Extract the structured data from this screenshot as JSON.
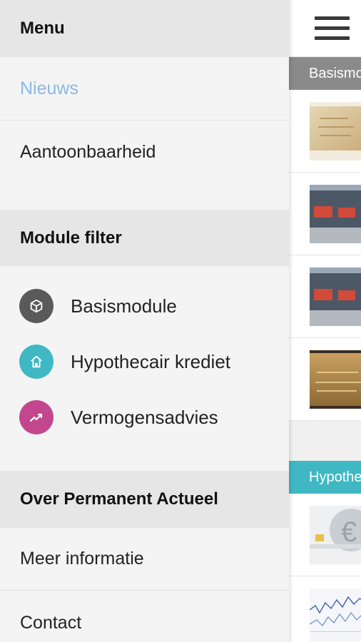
{
  "menu": {
    "title": "Menu",
    "items": [
      {
        "label": "Nieuws",
        "active": true
      },
      {
        "label": "Aantoonbaarheid",
        "active": false
      }
    ]
  },
  "module_filter": {
    "title": "Module filter",
    "items": [
      {
        "label": "Basismodule",
        "icon": "cube-icon",
        "color": "#5a5a5a"
      },
      {
        "label": "Hypothecair krediet",
        "icon": "house-icon",
        "color": "#3fb8c4"
      },
      {
        "label": "Vermogensadvies",
        "icon": "trend-line-icon",
        "color": "#c2478f"
      }
    ]
  },
  "about": {
    "title": "Over Permanent Actueel",
    "items": [
      {
        "label": "Meer informatie"
      },
      {
        "label": "Contact"
      }
    ]
  },
  "main": {
    "menu_icon": "hamburger-menu-icon",
    "sections": [
      {
        "label": "Basismo",
        "color": "#8a8a8a"
      },
      {
        "label": "Hypothe",
        "color": "#3fb8c4"
      }
    ]
  }
}
